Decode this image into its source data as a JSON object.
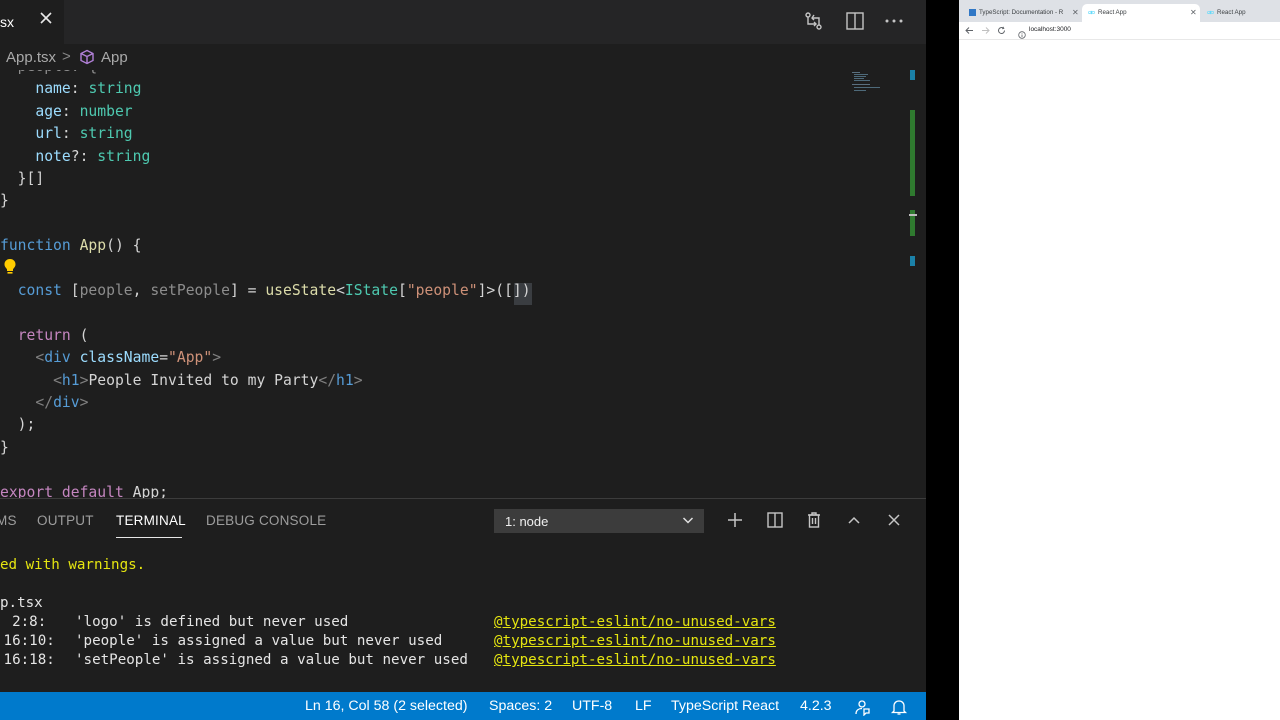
{
  "colors": {
    "editor_bg": "#1e1e1e",
    "statusbar_bg": "#007acc",
    "terminal_warning": "#e5e510",
    "keyword": "#569cd6",
    "type": "#4ec9b0",
    "string": "#ce9178",
    "function": "#dcdcaa",
    "variable": "#9cdcfe",
    "control": "#c586c0"
  },
  "editor": {
    "tab_label": "sx",
    "tab_close_icon": "close-icon",
    "toolbar_icons": [
      "compare-changes-icon",
      "split-editor-icon",
      "more-actions-icon"
    ],
    "breadcrumb": {
      "file": "App.tsx",
      "separator": ">",
      "symbol_icon": "symbol-class-icon",
      "symbol": "App"
    },
    "code": [
      {
        "tokens": [
          {
            "t": "  people: {",
            "c": "t-dim"
          }
        ]
      },
      {
        "tokens": [
          {
            "t": "    ",
            "c": "t-plain"
          },
          {
            "t": "name",
            "c": "t-key"
          },
          {
            "t": ": ",
            "c": "t-plain"
          },
          {
            "t": "string",
            "c": "t-type"
          }
        ]
      },
      {
        "tokens": [
          {
            "t": "    ",
            "c": "t-plain"
          },
          {
            "t": "age",
            "c": "t-key"
          },
          {
            "t": ": ",
            "c": "t-plain"
          },
          {
            "t": "number",
            "c": "t-type"
          }
        ]
      },
      {
        "tokens": [
          {
            "t": "    ",
            "c": "t-plain"
          },
          {
            "t": "url",
            "c": "t-key"
          },
          {
            "t": ": ",
            "c": "t-plain"
          },
          {
            "t": "string",
            "c": "t-type"
          }
        ]
      },
      {
        "tokens": [
          {
            "t": "    ",
            "c": "t-plain"
          },
          {
            "t": "note",
            "c": "t-key"
          },
          {
            "t": "?: ",
            "c": "t-plain"
          },
          {
            "t": "string",
            "c": "t-type"
          }
        ]
      },
      {
        "tokens": [
          {
            "t": "  }[]",
            "c": "t-plain"
          }
        ]
      },
      {
        "tokens": [
          {
            "t": "}",
            "c": "t-plain"
          }
        ]
      },
      {
        "tokens": []
      },
      {
        "tokens": [
          {
            "t": "function",
            "c": "t-kw"
          },
          {
            "t": " ",
            "c": "t-plain"
          },
          {
            "t": "App",
            "c": "t-fn"
          },
          {
            "t": "() {",
            "c": "t-plain"
          }
        ]
      },
      {
        "tokens": []
      },
      {
        "tokens": [
          {
            "t": "  ",
            "c": "t-plain"
          },
          {
            "t": "const",
            "c": "t-kw"
          },
          {
            "t": " [",
            "c": "t-plain"
          },
          {
            "t": "people",
            "c": "t-dim"
          },
          {
            "t": ", ",
            "c": "t-plain"
          },
          {
            "t": "setPeople",
            "c": "t-dim"
          },
          {
            "t": "] = ",
            "c": "t-plain"
          },
          {
            "t": "useState",
            "c": "t-fn"
          },
          {
            "t": "<",
            "c": "t-plain"
          },
          {
            "t": "IState",
            "c": "t-type"
          },
          {
            "t": "[",
            "c": "t-plain"
          },
          {
            "t": "\"people\"",
            "c": "t-str"
          },
          {
            "t": "]>([])",
            "c": "t-plain"
          }
        ]
      },
      {
        "tokens": []
      },
      {
        "tokens": [
          {
            "t": "  ",
            "c": "t-plain"
          },
          {
            "t": "return",
            "c": "t-ctrl"
          },
          {
            "t": " (",
            "c": "t-plain"
          }
        ]
      },
      {
        "tokens": [
          {
            "t": "    ",
            "c": "t-plain"
          },
          {
            "t": "<",
            "c": "t-punc"
          },
          {
            "t": "div",
            "c": "t-tag"
          },
          {
            "t": " ",
            "c": "t-plain"
          },
          {
            "t": "className",
            "c": "t-attr"
          },
          {
            "t": "=",
            "c": "t-plain"
          },
          {
            "t": "\"App\"",
            "c": "t-str"
          },
          {
            "t": ">",
            "c": "t-punc"
          }
        ]
      },
      {
        "tokens": [
          {
            "t": "      ",
            "c": "t-plain"
          },
          {
            "t": "<",
            "c": "t-punc"
          },
          {
            "t": "h1",
            "c": "t-tag"
          },
          {
            "t": ">",
            "c": "t-punc"
          },
          {
            "t": "People Invited to my Party",
            "c": "t-plain"
          },
          {
            "t": "</",
            "c": "t-punc"
          },
          {
            "t": "h1",
            "c": "t-tag"
          },
          {
            "t": ">",
            "c": "t-punc"
          }
        ]
      },
      {
        "tokens": [
          {
            "t": "    ",
            "c": "t-plain"
          },
          {
            "t": "</",
            "c": "t-punc"
          },
          {
            "t": "div",
            "c": "t-tag"
          },
          {
            "t": ">",
            "c": "t-punc"
          }
        ]
      },
      {
        "tokens": [
          {
            "t": "  );",
            "c": "t-plain"
          }
        ]
      },
      {
        "tokens": [
          {
            "t": "}",
            "c": "t-plain"
          }
        ]
      },
      {
        "tokens": []
      },
      {
        "tokens": [
          {
            "t": "export",
            "c": "t-ctrl"
          },
          {
            "t": " ",
            "c": "t-plain"
          },
          {
            "t": "default",
            "c": "t-ctrl"
          },
          {
            "t": " App;",
            "c": "t-plain"
          }
        ]
      }
    ]
  },
  "panel": {
    "tabs": [
      "MS",
      "OUTPUT",
      "TERMINAL",
      "DEBUG CONSOLE"
    ],
    "active_tab": "TERMINAL",
    "terminal_select": "1: node",
    "icons": [
      "chevron-down-icon",
      "new-terminal-icon",
      "split-terminal-icon",
      "trash-icon",
      "maximize-panel-icon",
      "close-panel-icon"
    ],
    "terminal": {
      "warning_line": "ed with warnings.",
      "file_line": "p.tsx",
      "rows": [
        {
          "loc": "  2:8:",
          "msg": "'logo' is defined but never used",
          "rule": "@typescript-eslint/no-unused-vars"
        },
        {
          "loc": " 16:10:",
          "msg": "'people' is assigned a value but never used",
          "rule": "@typescript-eslint/no-unused-vars"
        },
        {
          "loc": " 16:18:",
          "msg": "'setPeople' is assigned a value but never used",
          "rule": "@typescript-eslint/no-unused-vars"
        }
      ]
    }
  },
  "statusbar": {
    "position": "Ln 16, Col 58 (2 selected)",
    "spaces": "Spaces: 2",
    "encoding": "UTF-8",
    "eol": "LF",
    "language": "TypeScript React",
    "version": "4.2.3",
    "feedback_icon": "feedback-icon",
    "bell_icon": "bell-icon"
  },
  "browser": {
    "tabs": [
      {
        "label": "TypeScript: Documentation - R",
        "active": false
      },
      {
        "label": "React App",
        "active": true
      },
      {
        "label": "React App",
        "active": false
      }
    ],
    "url": "localhost:3000"
  }
}
